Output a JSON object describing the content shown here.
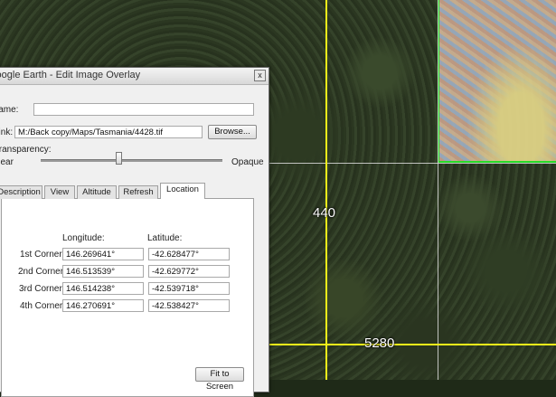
{
  "map": {
    "labels": [
      "440",
      "5280"
    ]
  },
  "dialog": {
    "title": "Google Earth - Edit Image Overlay",
    "close_glyph": "x",
    "name_label": "Name:",
    "name_value": "",
    "link_label": "Link:",
    "link_value": "M:/Back copy/Maps/Tasmania/4428.tif",
    "browse_label": "Browse...",
    "transparency_label": "Transparency:",
    "slider_min_label": "Clear",
    "slider_max_label": "Opaque",
    "transparency_fraction": 0.43,
    "tabs": [
      {
        "label": "Description",
        "active": false
      },
      {
        "label": "View",
        "active": false
      },
      {
        "label": "Altitude",
        "active": false
      },
      {
        "label": "Refresh",
        "active": false
      },
      {
        "label": "Location",
        "active": true
      }
    ],
    "location": {
      "longitude_header": "Longitude:",
      "latitude_header": "Latitude:",
      "corners": [
        {
          "label": "1st Corner:",
          "longitude": "146.269641°",
          "latitude": "-42.628477°"
        },
        {
          "label": "2nd Corner:",
          "longitude": "146.513539°",
          "latitude": "-42.629772°"
        },
        {
          "label": "3rd Corner:",
          "longitude": "146.514238°",
          "latitude": "-42.539718°"
        },
        {
          "label": "4th Corner:",
          "longitude": "146.270691°",
          "latitude": "-42.538427°"
        }
      ],
      "fit_button_label": "Fit to Screen"
    }
  }
}
